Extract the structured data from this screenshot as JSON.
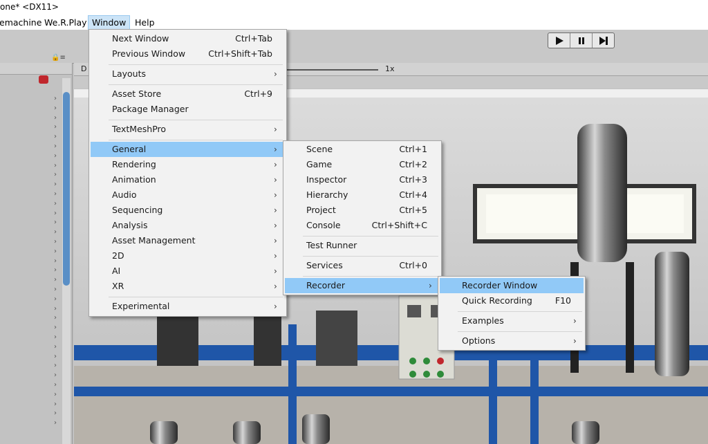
{
  "window": {
    "title": "one* <DX11>"
  },
  "menubar": {
    "items": [
      {
        "label": "emachine"
      },
      {
        "label": "We.R.Play"
      },
      {
        "label": "Window"
      },
      {
        "label": "Help"
      }
    ]
  },
  "game": {
    "tab_label": "D",
    "scale": "1x"
  },
  "window_menu": {
    "items": [
      {
        "label": "Next Window",
        "shortcut": "Ctrl+Tab"
      },
      {
        "label": "Previous Window",
        "shortcut": "Ctrl+Shift+Tab"
      },
      {
        "label": "Layouts",
        "submenu": true
      },
      {
        "label": "Asset Store",
        "shortcut": "Ctrl+9"
      },
      {
        "label": "Package Manager"
      },
      {
        "label": "TextMeshPro",
        "submenu": true
      },
      {
        "label": "General",
        "submenu": true,
        "highlighted": true
      },
      {
        "label": "Rendering",
        "submenu": true
      },
      {
        "label": "Animation",
        "submenu": true
      },
      {
        "label": "Audio",
        "submenu": true
      },
      {
        "label": "Sequencing",
        "submenu": true
      },
      {
        "label": "Analysis",
        "submenu": true
      },
      {
        "label": "Asset Management",
        "submenu": true
      },
      {
        "label": "2D",
        "submenu": true
      },
      {
        "label": "AI",
        "submenu": true
      },
      {
        "label": "XR",
        "submenu": true
      },
      {
        "label": "Experimental",
        "submenu": true
      }
    ]
  },
  "general_menu": {
    "items": [
      {
        "label": "Scene",
        "shortcut": "Ctrl+1"
      },
      {
        "label": "Game",
        "shortcut": "Ctrl+2"
      },
      {
        "label": "Inspector",
        "shortcut": "Ctrl+3"
      },
      {
        "label": "Hierarchy",
        "shortcut": "Ctrl+4"
      },
      {
        "label": "Project",
        "shortcut": "Ctrl+5"
      },
      {
        "label": "Console",
        "shortcut": "Ctrl+Shift+C"
      },
      {
        "label": "Test Runner"
      },
      {
        "label": "Services",
        "shortcut": "Ctrl+0"
      },
      {
        "label": "Recorder",
        "submenu": true,
        "highlighted": true
      }
    ]
  },
  "recorder_menu": {
    "items": [
      {
        "label": "Recorder Window",
        "highlighted": true
      },
      {
        "label": "Quick Recording",
        "shortcut": "F10"
      },
      {
        "label": "Examples",
        "submenu": true
      },
      {
        "label": "Options",
        "submenu": true
      }
    ]
  },
  "colors": {
    "highlight": "#91c9f7",
    "menu_bg": "#f2f2f2",
    "scene_blue": "#1f56a8"
  },
  "icons": {
    "play": "play-icon",
    "pause": "pause-icon",
    "step": "step-icon",
    "submenu": "chevron-right-icon"
  }
}
